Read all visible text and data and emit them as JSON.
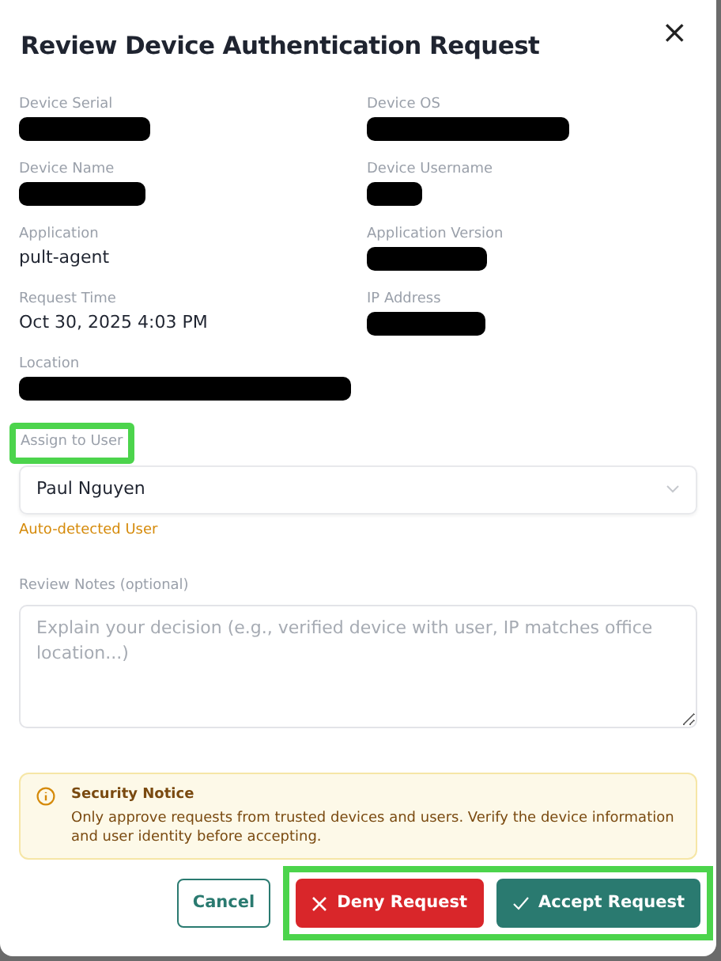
{
  "dialog": {
    "title": "Review Device Authentication Request",
    "close": "×"
  },
  "fields": [
    {
      "label": "Device Serial",
      "redacted": true
    },
    {
      "label": "Device OS",
      "redacted": true
    },
    {
      "label": "Device Name",
      "redacted": true
    },
    {
      "label": "Device Username",
      "redacted": true
    },
    {
      "label": "Application",
      "value": "pult-agent",
      "redacted": false
    },
    {
      "label": "Application Version",
      "redacted": true
    },
    {
      "label": "Request Time",
      "value": "Oct 30, 2025 4:03 PM",
      "redacted": false
    },
    {
      "label": "IP Address",
      "redacted": true
    },
    {
      "label": "Location",
      "redacted": true
    }
  ],
  "assign": {
    "label": "Assign to User",
    "highlighted": true,
    "value": "Paul Nguyen",
    "hint": "Auto-detected User"
  },
  "notes": {
    "label": "Review Notes (optional)",
    "placeholder": "Explain your decision (e.g., verified device with user, IP matches office location...)"
  },
  "notice": {
    "title": "Security Notice",
    "text": "Only approve requests from trusted devices and users. Verify the device information and user identity before accepting."
  },
  "buttons": [
    {
      "kind": "cancel",
      "label": "Cancel"
    },
    {
      "kind": "deny",
      "label": "Deny Request"
    },
    {
      "kind": "accept",
      "label": "Accept Request"
    }
  ],
  "actions_highlighted": true
}
